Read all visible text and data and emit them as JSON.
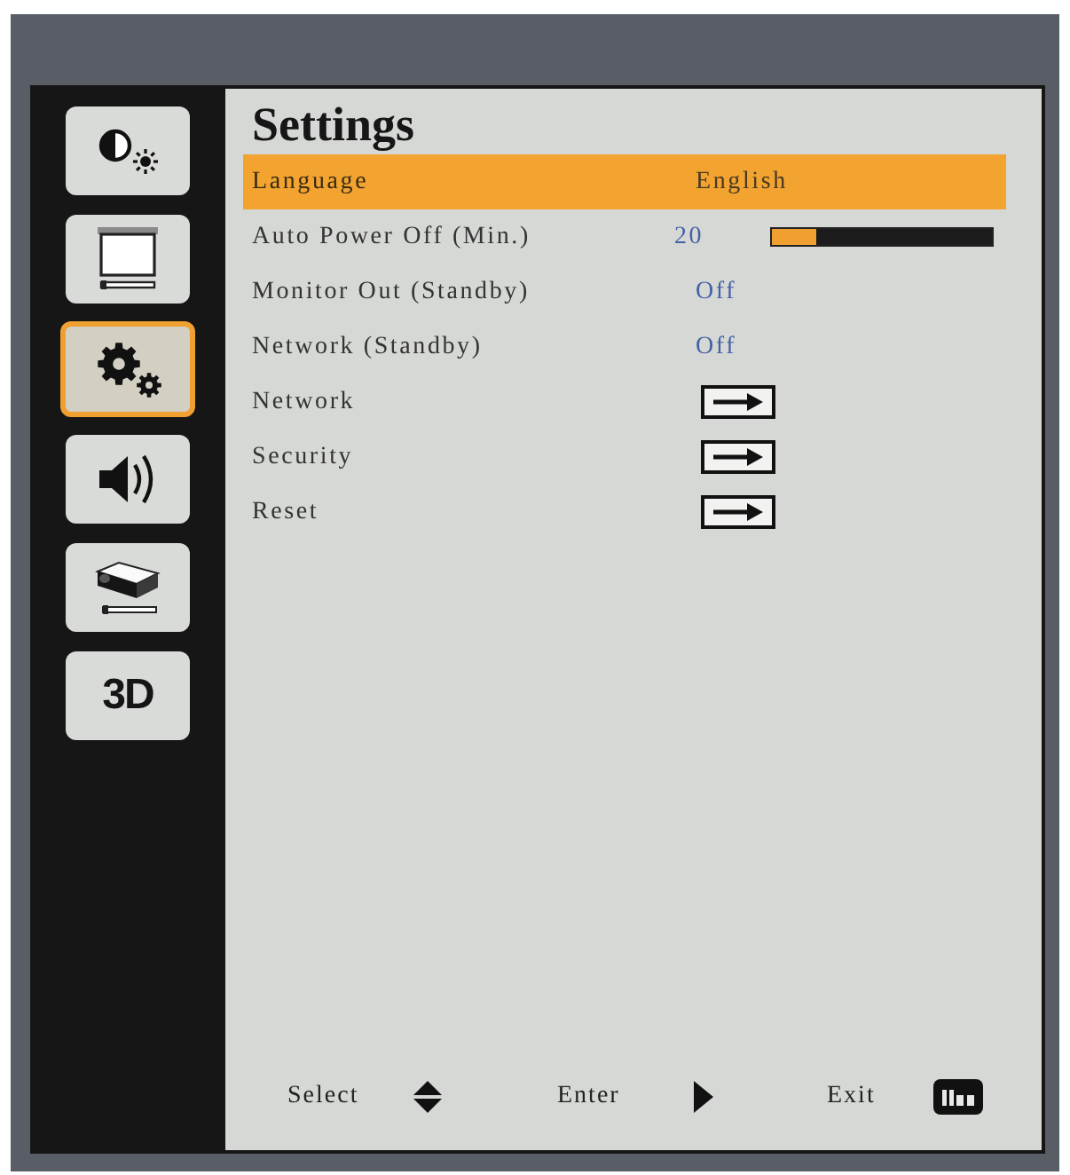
{
  "sidebar": {
    "items": [
      {
        "kind": "picture",
        "selected": false
      },
      {
        "kind": "screen",
        "selected": false
      },
      {
        "kind": "gears",
        "selected": true
      },
      {
        "kind": "speaker",
        "selected": false
      },
      {
        "kind": "projector",
        "selected": false
      },
      {
        "kind": "text",
        "label": "3D",
        "selected": false
      }
    ]
  },
  "menu": {
    "title": "Settings",
    "rows": [
      {
        "kind": "value",
        "label": "Language",
        "value": "English",
        "selected": true
      },
      {
        "kind": "slider",
        "label": "Auto Power Off (Min.)",
        "value": "20",
        "level": 0.2,
        "selected": false
      },
      {
        "kind": "value",
        "label": "Monitor Out (Standby)",
        "value": "Off",
        "selected": false
      },
      {
        "kind": "value",
        "label": "Network (Standby)",
        "value": "Off",
        "selected": false
      },
      {
        "kind": "submenu",
        "label": "Network",
        "selected": false
      },
      {
        "kind": "submenu",
        "label": "Security",
        "selected": false
      },
      {
        "kind": "submenu",
        "label": "Reset",
        "selected": false
      }
    ]
  },
  "footer": {
    "hints": [
      {
        "kind": "updown",
        "label": "Select"
      },
      {
        "kind": "right",
        "label": "Enter"
      },
      {
        "kind": "menu",
        "label": "Exit"
      }
    ]
  }
}
